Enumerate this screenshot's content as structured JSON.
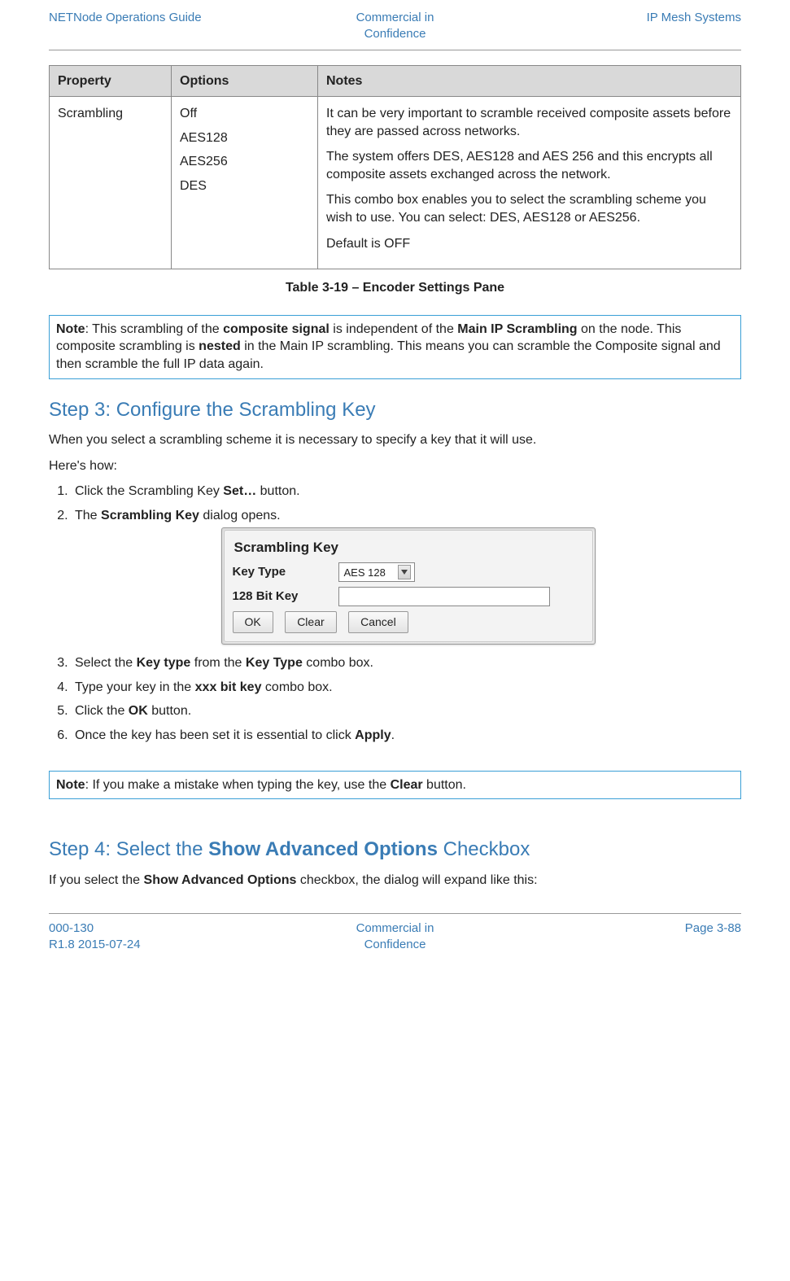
{
  "header": {
    "left": "NETNode Operations Guide",
    "center": "Commercial in\nConfidence",
    "right": "IP Mesh Systems"
  },
  "table": {
    "headers": {
      "property": "Property",
      "options": "Options",
      "notes": "Notes"
    },
    "row": {
      "property": "Scrambling",
      "options": [
        "Off",
        "AES128",
        "AES256",
        "DES"
      ],
      "notes": [
        "It can be very important to scramble received composite assets before they are passed across networks.",
        "The system offers DES, AES128 and AES 256 and this encrypts all composite assets exchanged across the network.",
        "This combo box enables you to select the scrambling scheme you wish to use. You can select: DES, AES128 or AES256.",
        "Default is OFF"
      ]
    }
  },
  "caption": "Table 3-19 – Encoder Settings Pane",
  "note1": {
    "prefix": "Note",
    "text_parts": [
      ": This scrambling of the ",
      "composite signal",
      " is independent of the ",
      "Main IP Scrambling",
      " on the node. This composite scrambling is ",
      "nested",
      " in the Main IP scrambling. This means you can scramble the Composite signal and then scramble the full IP data again."
    ]
  },
  "step3": {
    "heading": "Step 3: Configure the Scrambling Key",
    "para1": "When you select a scrambling scheme it is necessary to specify a key that it will use.",
    "para2": "Here's how:",
    "items": {
      "i1_a": "Click the Scrambling Key ",
      "i1_b": "Set…",
      "i1_c": " button.",
      "i2_a": "The ",
      "i2_b": "Scrambling Key",
      "i2_c": " dialog opens.",
      "i3_a": "Select the ",
      "i3_b": "Key type",
      "i3_c": " from the ",
      "i3_d": "Key Type",
      "i3_e": " combo box.",
      "i4_a": "Type your key in the ",
      "i4_b": "xxx bit key",
      "i4_c": " combo box.",
      "i5_a": "Click the ",
      "i5_b": "OK",
      "i5_c": " button.",
      "i6_a": "Once the key has been set it is essential to click ",
      "i6_b": "Apply",
      "i6_c": "."
    }
  },
  "dialog": {
    "title": "Scrambling Key",
    "row1_label": "Key Type",
    "row1_value": "AES 128",
    "row2_label": "128 Bit Key",
    "btn_ok": "OK",
    "btn_clear": "Clear",
    "btn_cancel": "Cancel"
  },
  "note2": {
    "prefix": "Note",
    "a": ": If you make a mistake when typing the key, use the ",
    "b": "Clear",
    "c": " button."
  },
  "step4": {
    "heading_a": "Step 4: Select the ",
    "heading_b": "Show Advanced Options",
    "heading_c": " Checkbox",
    "para_a": "If you select the ",
    "para_b": "Show Advanced Options",
    "para_c": " checkbox, the dialog will expand like this:"
  },
  "footer": {
    "left1": "000-130",
    "left2": "R1.8 2015-07-24",
    "center": "Commercial in\nConfidence",
    "right": "Page 3-88"
  }
}
